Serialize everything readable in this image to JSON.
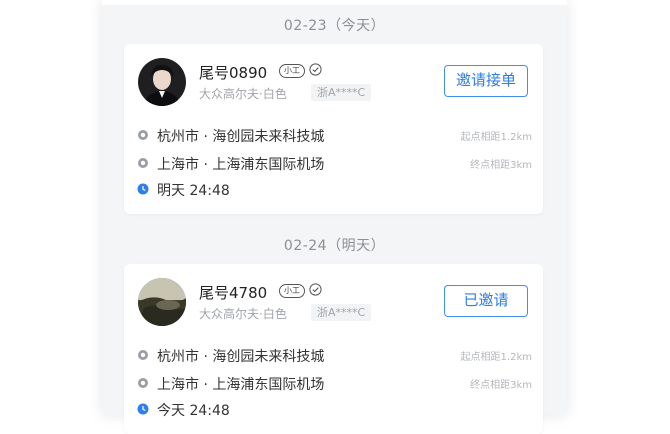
{
  "colors": {
    "accent": "#3f8ef0",
    "time_dot": "#2f7fe8",
    "place_dot": "#9a9ea5"
  },
  "groups": [
    {
      "date": "02-23（今天）",
      "card": {
        "driver": "尾号0890",
        "level_badge": "小工",
        "verified_icon": "verified-check-icon",
        "car": "大众高尔夫·白色",
        "plate": "浙A****C",
        "action": "邀请接单",
        "from": "杭州市 · 海创园未来科技城",
        "from_distance": "起点相距1.2km",
        "to": "上海市 · 上海浦东国际机场",
        "to_distance": "终点相距3km",
        "time": "明天 24:48"
      }
    },
    {
      "date": "02-24（明天）",
      "card": {
        "driver": "尾号4780",
        "level_badge": "小工",
        "verified_icon": "verified-check-icon",
        "car": "大众高尔夫·白色",
        "plate": "浙A****C",
        "action": "已邀请",
        "from": "杭州市 · 海创园未来科技城",
        "from_distance": "起点相距1.2km",
        "to": "上海市 · 上海浦东国际机场",
        "to_distance": "终点相距3km",
        "time": "今天 24:48"
      }
    }
  ]
}
